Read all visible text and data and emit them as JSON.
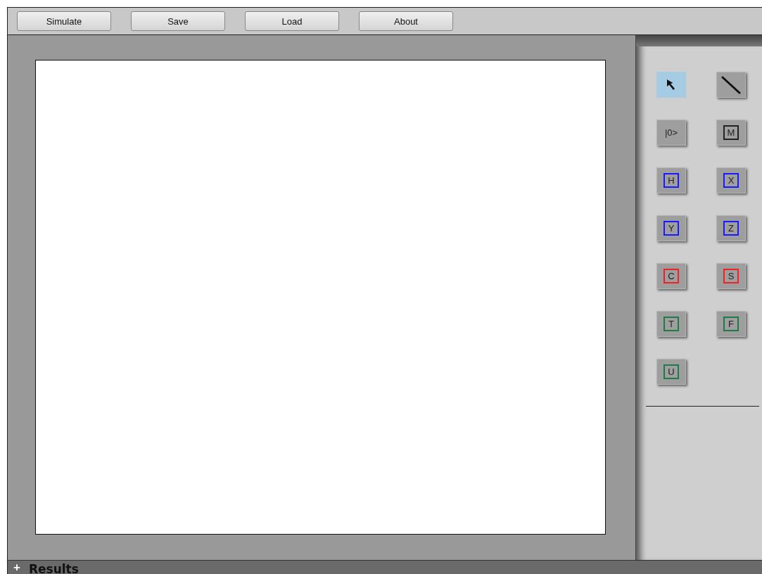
{
  "toolbar": [
    {
      "label": "Simulate"
    },
    {
      "label": "Save"
    },
    {
      "label": "Load"
    },
    {
      "label": "About"
    }
  ],
  "tools": [
    {
      "kind": "pointer",
      "selected": true
    },
    {
      "kind": "wire",
      "selected": false
    },
    {
      "kind": "gate",
      "label": "|0>",
      "selected": false
    },
    {
      "kind": "gate",
      "label": "M",
      "color": "#222222",
      "selected": false
    },
    {
      "kind": "gate",
      "label": "H",
      "color": "#1a1aff",
      "selected": false
    },
    {
      "kind": "gate",
      "label": "X",
      "color": "#1a1aff",
      "selected": false
    },
    {
      "kind": "gate",
      "label": "Y",
      "color": "#1a1aff",
      "selected": false
    },
    {
      "kind": "gate",
      "label": "Z",
      "color": "#1a1aff",
      "selected": false
    },
    {
      "kind": "gate",
      "label": "C",
      "color": "#ee2222",
      "selected": false
    },
    {
      "kind": "gate",
      "label": "S",
      "color": "#ee2222",
      "selected": false
    },
    {
      "kind": "gate",
      "label": "T",
      "color": "#1e7a46",
      "selected": false
    },
    {
      "kind": "gate",
      "label": "F",
      "color": "#1e7a46",
      "selected": false
    },
    {
      "kind": "gate",
      "label": "U",
      "color": "#1e7a46",
      "selected": false
    }
  ],
  "results_panel": {
    "toggle": "+",
    "title": "Results"
  }
}
